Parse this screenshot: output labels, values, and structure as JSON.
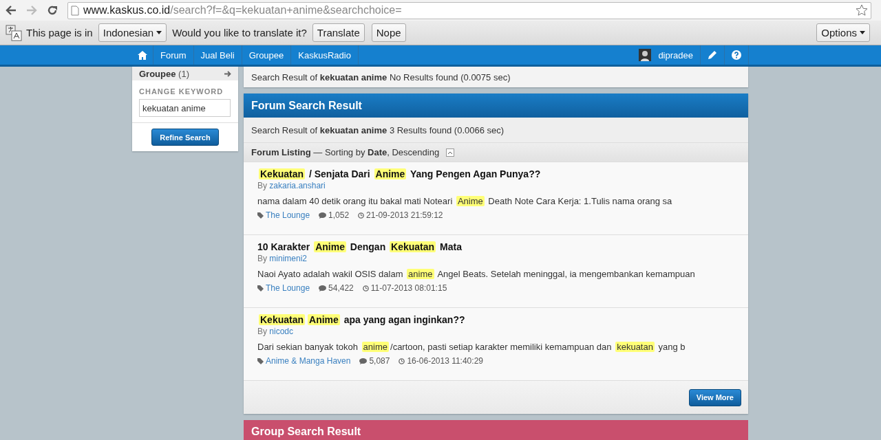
{
  "browser": {
    "url_host": "www.kaskus.co.id",
    "url_path": "/search?f=&q=kekuatan+anime&searchchoice="
  },
  "translate_bar": {
    "prefix": "This page is in",
    "language": "Indonesian",
    "question": "Would you like to translate it?",
    "buttons": [
      "Translate",
      "Nope"
    ],
    "options": "Options"
  },
  "nav": {
    "items": [
      "Forum",
      "Jual Beli",
      "Groupee",
      "KaskusRadio"
    ],
    "user": "dipradee"
  },
  "sidebar": {
    "group_label": "Groupee",
    "group_count": "(1)",
    "keyword_label": "CHANGE KEYWORD",
    "keyword_value": "kekuatan anime",
    "button": "Refine Search"
  },
  "top_result": {
    "text": "Search Result of **kekuatan anime**  No Results found (0.0075 sec)"
  },
  "forum": {
    "title": "Forum Search Result",
    "summary": "Search Result of **kekuatan anime** 3 Results found (0.0066 sec)",
    "listing": "**Forum Listing** — Sorting by **Date**, Descending",
    "threads": [
      {
        "title": [
          {
            "text": "Kekuatan",
            "highlight": true
          },
          {
            "text": " / Senjata Dari ",
            "highlight": false
          },
          {
            "text": "Anime",
            "highlight": true
          },
          {
            "text": " Yang Pengen Agan Punya??",
            "highlight": false
          }
        ],
        "by": "By",
        "author": "zakaria.anshari",
        "snippet": [
          {
            "text": "nama dalam 40 detik orang itu bakal mati Noteari ",
            "highlight": false
          },
          {
            "text": "Anime",
            "highlight": true
          },
          {
            "text": " Death Note Cara Kerja: 1.Tulis nama orang sa",
            "highlight": false
          }
        ],
        "forum": "The Lounge",
        "replies": "1,052",
        "date": "21-09-2013 21:59:12"
      },
      {
        "title": [
          {
            "text": "10 Karakter ",
            "highlight": false
          },
          {
            "text": "Anime",
            "highlight": true
          },
          {
            "text": " Dengan ",
            "highlight": false
          },
          {
            "text": "Kekuatan",
            "highlight": true
          },
          {
            "text": " Mata",
            "highlight": false
          }
        ],
        "by": "By",
        "author": "minimeni2",
        "snippet": [
          {
            "text": "Naoi Ayato adalah wakil OSIS dalam ",
            "highlight": false
          },
          {
            "text": "anime",
            "highlight": true
          },
          {
            "text": " Angel Beats. Setelah meninggal, ia mengembankan kemampuan",
            "highlight": false
          }
        ],
        "forum": "The Lounge",
        "replies": "54,422",
        "date": "11-07-2013 08:01:15"
      },
      {
        "title": [
          {
            "text": "Kekuatan",
            "highlight": true
          },
          {
            "text": "Anime",
            "highlight": true
          },
          {
            "text": " apa yang agan inginkan??",
            "highlight": false
          }
        ],
        "by": "By",
        "author": "nicodc",
        "snippet": [
          {
            "text": "Dari sekian banyak tokoh ",
            "highlight": false
          },
          {
            "text": "anime",
            "highlight": true
          },
          {
            "text": "/cartoon, pasti setiap karakter memiliki kemampuan dan ",
            "highlight": false
          },
          {
            "text": "kekuatan",
            "highlight": true
          },
          {
            "text": " yang b",
            "highlight": false
          }
        ],
        "forum": "Anime & Manga Haven",
        "replies": "5,087",
        "date": "16-06-2013 11:40:29"
      }
    ],
    "view_more": "View More"
  },
  "group": {
    "title": "Group Search Result"
  }
}
